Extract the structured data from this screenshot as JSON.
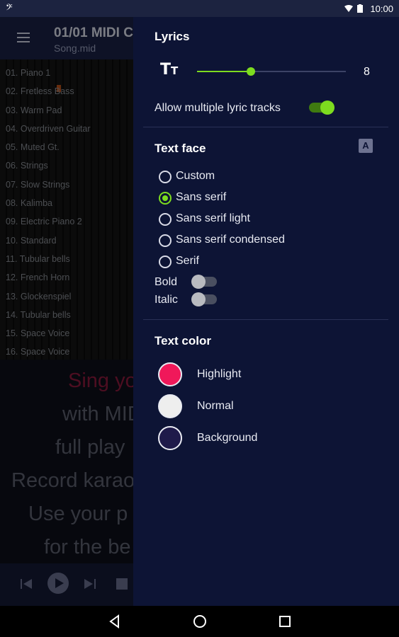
{
  "status_bar": {
    "time": "10:00",
    "left_icon": "bass-clef-icon"
  },
  "toolbar": {
    "title": "01/01 MIDI C",
    "subtitle": "Song.mid"
  },
  "tracks": [
    "01. Piano 1",
    "02. Fretless Bass",
    "03. Warm Pad",
    "04. Overdriven Guitar",
    "05. Muted Gt.",
    "06. Strings",
    "07. Slow Strings",
    "08. Kalimba",
    "09. Electric Piano 2",
    "10. Standard",
    "11. Tubular bells",
    "12. French Horn",
    "13. Glockenspiel",
    "14. Tubular bells",
    "15. Space Voice",
    "16. Space Voice"
  ],
  "lyrics": [
    "Sing yo",
    "with MID",
    "full play",
    "Record karaok",
    "Use your p",
    "for the be"
  ],
  "panel": {
    "lyrics_title": "Lyrics",
    "font_size_value": "8",
    "font_size_fraction": 0.36,
    "allow_multiple_label": "Allow multiple lyric tracks",
    "allow_multiple_on": true,
    "text_face_title": "Text face",
    "font_icon_label": "A",
    "faces": [
      "Custom",
      "Sans serif",
      "Sans serif light",
      "Sans serif condensed",
      "Serif"
    ],
    "selected_face": "Sans serif",
    "bold_label": "Bold",
    "italic_label": "Italic",
    "text_color_title": "Text color",
    "colors": [
      {
        "label": "Highlight",
        "color": "#f0185a"
      },
      {
        "label": "Normal",
        "color": "#eeeeee"
      },
      {
        "label": "Background",
        "color": "#1f1a4a"
      }
    ]
  },
  "colors": {
    "accent": "#7ddc1f",
    "panel_bg": "#0d1435",
    "toolbar_bg": "#1a2246"
  }
}
